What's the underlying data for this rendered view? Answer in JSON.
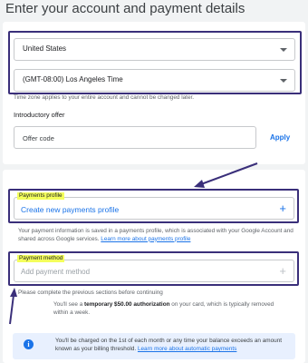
{
  "page": {
    "title": "Enter your account and payment details"
  },
  "country": {
    "value": "United States"
  },
  "timezone": {
    "value": "(GMT-08:00) Los Angeles Time",
    "note": "Time zone applies to your entire account and cannot be changed later."
  },
  "offer": {
    "label": "Introductory offer",
    "placeholder": "Offer code",
    "apply_label": "Apply"
  },
  "payments_profile": {
    "tag": "Payments profile",
    "action_label": "Create new payments profile",
    "note_text": "Your payment information is saved in a payments profile, which is associated with your Google Account and shared across Google services.",
    "note_link": "Learn more about payments profile"
  },
  "payment_method": {
    "tag": "Payment method",
    "placeholder": "Add payment method",
    "note": "Please complete the previous sections before continuing",
    "auth_prefix": "You'll see a ",
    "auth_bold": "temporary $50.00 authorization",
    "auth_suffix": " on your card, which is typically removed within a week."
  },
  "billing_info": {
    "text": "You'll be charged on the 1st of each month or any time your balance exceeds an amount known as your billing threshold.",
    "link": "Learn more about automatic payments"
  },
  "colors": {
    "accent": "#1a73e8",
    "highlight": "#f4ff5c",
    "frame": "#3a2f7a",
    "info_bg": "#e8f0fe"
  },
  "icons": [
    "dropdown-caret",
    "plus-icon",
    "info-icon",
    "arrow-annotation"
  ]
}
